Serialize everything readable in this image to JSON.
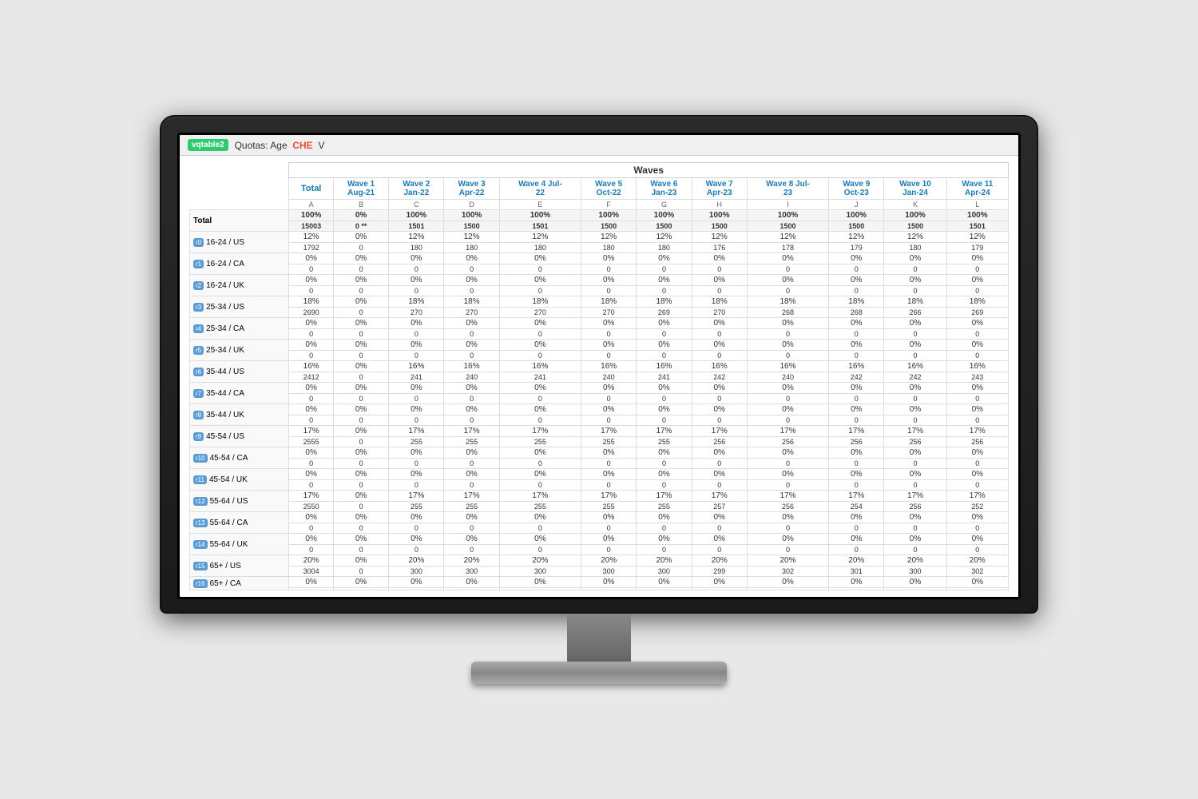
{
  "app": {
    "logo": "vqtable2",
    "title": "Quotas: Age",
    "che_label": "CHE",
    "v_label": "V"
  },
  "table": {
    "waves_label": "Waves",
    "columns": [
      {
        "id": "total",
        "wave": "Total",
        "letter": "A"
      },
      {
        "id": "w1",
        "wave": "Wave 1",
        "sub": "Aug-21",
        "letter": "B"
      },
      {
        "id": "w2",
        "wave": "Wave 2",
        "sub": "Jan-22",
        "letter": "C"
      },
      {
        "id": "w3",
        "wave": "Wave 3",
        "sub": "Apr-22",
        "letter": "D"
      },
      {
        "id": "w4",
        "wave": "Wave 4 Jul-",
        "sub": "22",
        "letter": "E"
      },
      {
        "id": "w5",
        "wave": "Wave 5",
        "sub": "Oct-22",
        "letter": "F"
      },
      {
        "id": "w6",
        "wave": "Wave 6",
        "sub": "Jan-23",
        "letter": "G"
      },
      {
        "id": "w7",
        "wave": "Wave 7",
        "sub": "Apr-23",
        "letter": "H"
      },
      {
        "id": "w8",
        "wave": "Wave 8 Jul-",
        "sub": "23",
        "letter": "I"
      },
      {
        "id": "w9",
        "wave": "Wave 9",
        "sub": "Oct-23",
        "letter": "J"
      },
      {
        "id": "w10",
        "wave": "Wave 10",
        "sub": "Jan-24",
        "letter": "K"
      },
      {
        "id": "w11",
        "wave": "Wave 11",
        "sub": "Apr-24",
        "letter": "L"
      }
    ],
    "rows": [
      {
        "label": "Total",
        "badge": null,
        "is_total": true,
        "pct": [
          "100%",
          "0%",
          "100%",
          "100%",
          "100%",
          "100%",
          "100%",
          "100%",
          "100%",
          "100%",
          "100%",
          "100%"
        ],
        "n": [
          "15003",
          "0 **",
          "1501",
          "1500",
          "1501",
          "1500",
          "1500",
          "1500",
          "1500",
          "1500",
          "1500",
          "1501"
        ]
      },
      {
        "label": "16-24 / US",
        "badge": "r0",
        "pct": [
          "12%",
          "0%",
          "12%",
          "12%",
          "12%",
          "12%",
          "12%",
          "12%",
          "12%",
          "12%",
          "12%",
          "12%"
        ],
        "n": [
          "1792",
          "0",
          "180",
          "180",
          "180",
          "180",
          "180",
          "176",
          "178",
          "179",
          "180",
          "179"
        ]
      },
      {
        "label": "16-24 / CA",
        "badge": "r1",
        "pct": [
          "0%",
          "0%",
          "0%",
          "0%",
          "0%",
          "0%",
          "0%",
          "0%",
          "0%",
          "0%",
          "0%",
          "0%"
        ],
        "n": [
          "0",
          "0",
          "0",
          "0",
          "0",
          "0",
          "0",
          "0",
          "0",
          "0",
          "0",
          "0"
        ]
      },
      {
        "label": "16-24 / UK",
        "badge": "r2",
        "pct": [
          "0%",
          "0%",
          "0%",
          "0%",
          "0%",
          "0%",
          "0%",
          "0%",
          "0%",
          "0%",
          "0%",
          "0%"
        ],
        "n": [
          "0",
          "0",
          "0",
          "0",
          "0",
          "0",
          "0",
          "0",
          "0",
          "0",
          "0",
          "0"
        ]
      },
      {
        "label": "25-34 / US",
        "badge": "r3",
        "pct": [
          "18%",
          "0%",
          "18%",
          "18%",
          "18%",
          "18%",
          "18%",
          "18%",
          "18%",
          "18%",
          "18%",
          "18%"
        ],
        "n": [
          "2690",
          "0",
          "270",
          "270",
          "270",
          "270",
          "269",
          "270",
          "268",
          "268",
          "266",
          "269"
        ]
      },
      {
        "label": "25-34 / CA",
        "badge": "r4",
        "pct": [
          "0%",
          "0%",
          "0%",
          "0%",
          "0%",
          "0%",
          "0%",
          "0%",
          "0%",
          "0%",
          "0%",
          "0%"
        ],
        "n": [
          "0",
          "0",
          "0",
          "0",
          "0",
          "0",
          "0",
          "0",
          "0",
          "0",
          "0",
          "0"
        ]
      },
      {
        "label": "25-34 / UK",
        "badge": "r5",
        "pct": [
          "0%",
          "0%",
          "0%",
          "0%",
          "0%",
          "0%",
          "0%",
          "0%",
          "0%",
          "0%",
          "0%",
          "0%"
        ],
        "n": [
          "0",
          "0",
          "0",
          "0",
          "0",
          "0",
          "0",
          "0",
          "0",
          "0",
          "0",
          "0"
        ]
      },
      {
        "label": "35-44 / US",
        "badge": "r6",
        "pct": [
          "16%",
          "0%",
          "16%",
          "16%",
          "16%",
          "16%",
          "16%",
          "16%",
          "16%",
          "16%",
          "16%",
          "16%"
        ],
        "n": [
          "2412",
          "0",
          "241",
          "240",
          "241",
          "240",
          "241",
          "242",
          "240",
          "242",
          "242",
          "243"
        ]
      },
      {
        "label": "35-44 / CA",
        "badge": "r7",
        "pct": [
          "0%",
          "0%",
          "0%",
          "0%",
          "0%",
          "0%",
          "0%",
          "0%",
          "0%",
          "0%",
          "0%",
          "0%"
        ],
        "n": [
          "0",
          "0",
          "0",
          "0",
          "0",
          "0",
          "0",
          "0",
          "0",
          "0",
          "0",
          "0"
        ]
      },
      {
        "label": "35-44 / UK",
        "badge": "r8",
        "pct": [
          "0%",
          "0%",
          "0%",
          "0%",
          "0%",
          "0%",
          "0%",
          "0%",
          "0%",
          "0%",
          "0%",
          "0%"
        ],
        "n": [
          "0",
          "0",
          "0",
          "0",
          "0",
          "0",
          "0",
          "0",
          "0",
          "0",
          "0",
          "0"
        ]
      },
      {
        "label": "45-54 / US",
        "badge": "r9",
        "pct": [
          "17%",
          "0%",
          "17%",
          "17%",
          "17%",
          "17%",
          "17%",
          "17%",
          "17%",
          "17%",
          "17%",
          "17%"
        ],
        "n": [
          "2555",
          "0",
          "255",
          "255",
          "255",
          "255",
          "255",
          "256",
          "256",
          "256",
          "256",
          "256"
        ]
      },
      {
        "label": "45-54 / CA",
        "badge": "r10",
        "pct": [
          "0%",
          "0%",
          "0%",
          "0%",
          "0%",
          "0%",
          "0%",
          "0%",
          "0%",
          "0%",
          "0%",
          "0%"
        ],
        "n": [
          "0",
          "0",
          "0",
          "0",
          "0",
          "0",
          "0",
          "0",
          "0",
          "0",
          "0",
          "0"
        ]
      },
      {
        "label": "45-54 / UK",
        "badge": "r11",
        "pct": [
          "0%",
          "0%",
          "0%",
          "0%",
          "0%",
          "0%",
          "0%",
          "0%",
          "0%",
          "0%",
          "0%",
          "0%"
        ],
        "n": [
          "0",
          "0",
          "0",
          "0",
          "0",
          "0",
          "0",
          "0",
          "0",
          "0",
          "0",
          "0"
        ]
      },
      {
        "label": "55-64 / US",
        "badge": "r12",
        "pct": [
          "17%",
          "0%",
          "17%",
          "17%",
          "17%",
          "17%",
          "17%",
          "17%",
          "17%",
          "17%",
          "17%",
          "17%"
        ],
        "n": [
          "2550",
          "0",
          "255",
          "255",
          "255",
          "255",
          "255",
          "257",
          "256",
          "254",
          "256",
          "252"
        ]
      },
      {
        "label": "55-64 / CA",
        "badge": "r13",
        "pct": [
          "0%",
          "0%",
          "0%",
          "0%",
          "0%",
          "0%",
          "0%",
          "0%",
          "0%",
          "0%",
          "0%",
          "0%"
        ],
        "n": [
          "0",
          "0",
          "0",
          "0",
          "0",
          "0",
          "0",
          "0",
          "0",
          "0",
          "0",
          "0"
        ]
      },
      {
        "label": "55-64 / UK",
        "badge": "r14",
        "pct": [
          "0%",
          "0%",
          "0%",
          "0%",
          "0%",
          "0%",
          "0%",
          "0%",
          "0%",
          "0%",
          "0%",
          "0%"
        ],
        "n": [
          "0",
          "0",
          "0",
          "0",
          "0",
          "0",
          "0",
          "0",
          "0",
          "0",
          "0",
          "0"
        ]
      },
      {
        "label": "65+ / US",
        "badge": "r15",
        "pct": [
          "20%",
          "0%",
          "20%",
          "20%",
          "20%",
          "20%",
          "20%",
          "20%",
          "20%",
          "20%",
          "20%",
          "20%"
        ],
        "n": [
          "3004",
          "0",
          "300",
          "300",
          "300",
          "300",
          "300",
          "299",
          "302",
          "301",
          "300",
          "302"
        ]
      },
      {
        "label": "65+ / CA",
        "badge": "r16",
        "pct": [
          "0%",
          "0%",
          "0%",
          "0%",
          "0%",
          "0%",
          "0%",
          "0%",
          "0%",
          "0%",
          "0%",
          "0%"
        ],
        "n": [
          "",
          "",
          "",
          "",
          "",
          "",
          "",
          "",
          "",
          "",
          "",
          ""
        ]
      }
    ]
  }
}
